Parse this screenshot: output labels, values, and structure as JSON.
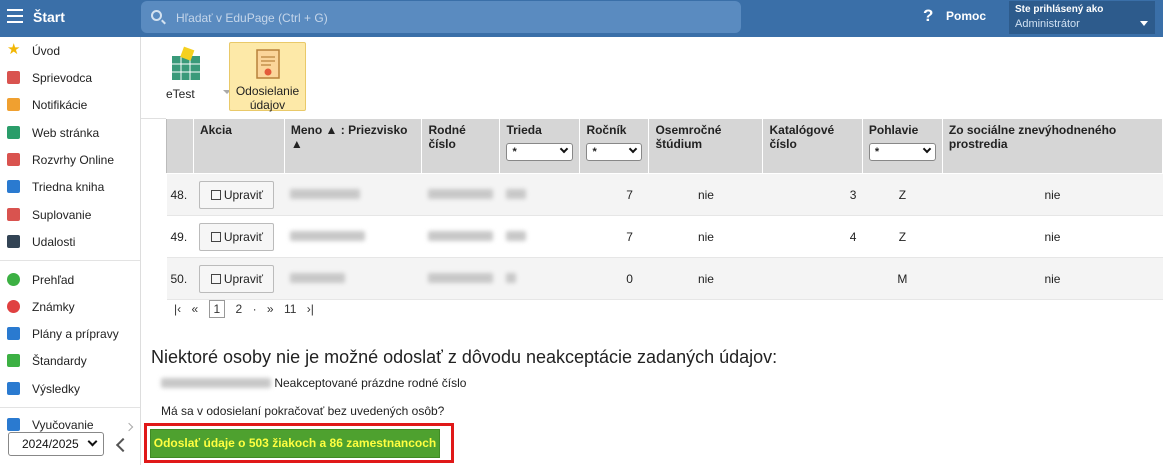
{
  "topbar": {
    "start_label": "Štart",
    "search_placeholder": "Hľadať v EduPage (Ctrl + G)",
    "help_label": "Pomoc",
    "logged_in_label": "Ste prihlásený ako",
    "user_role": "Administrátor"
  },
  "sidebar": {
    "items": [
      {
        "label": "Úvod",
        "icon": "star-icon",
        "color": "#f2b705"
      },
      {
        "label": "Sprievodca",
        "icon": "wand-icon",
        "color": "#d9534f"
      },
      {
        "label": "Notifikácie",
        "icon": "envelope-icon",
        "color": "#f0a030"
      },
      {
        "label": "Web stránka",
        "icon": "home-icon",
        "color": "#2a9d6a"
      },
      {
        "label": "Rozvrhy Online",
        "icon": "calendar-grid-icon",
        "color": "#d9534f"
      },
      {
        "label": "Triedna kniha",
        "icon": "book-icon",
        "color": "#2a7ad0"
      },
      {
        "label": "Suplovanie",
        "icon": "person-icon",
        "color": "#d9534f"
      },
      {
        "label": "Udalosti",
        "icon": "calendar-icon",
        "color": "#334455"
      },
      {
        "label": "Prehľad",
        "icon": "check-circle-icon",
        "color": "#3cb043"
      },
      {
        "label": "Známky",
        "icon": "x-circle-icon",
        "color": "#e04040"
      },
      {
        "label": "Plány a prípravy",
        "icon": "briefcase-icon",
        "color": "#2a7ad0"
      },
      {
        "label": "Štandardy",
        "icon": "shield-check-icon",
        "color": "#3cb043"
      },
      {
        "label": "Výsledky",
        "icon": "bar-chart-icon",
        "color": "#2a7ad0"
      },
      {
        "label": "Vyučovanie",
        "icon": "layers-icon",
        "color": "#2a7ad0"
      }
    ],
    "year": "2024/2025"
  },
  "toolbar": {
    "etest_label": "eTest",
    "send_label_1": "Odosielanie",
    "send_label_2": "údajov"
  },
  "table": {
    "headers": {
      "akcia": "Akcia",
      "meno": "Meno",
      "priezvisko": "Priezvisko",
      "rodne_1": "Rodné",
      "rodne_2": "číslo",
      "trieda": "Trieda",
      "rocnik": "Ročník",
      "osem_1": "Osemročné",
      "osem_2": "štúdium",
      "katal_1": "Katalógové",
      "katal_2": "číslo",
      "pohlavie": "Pohlavie",
      "soc_1": "Zo sociálne znevýhodneného",
      "soc_2": "prostredia",
      "filter_value": "*"
    },
    "edit_label": "Upraviť",
    "rows": [
      {
        "num": "48.",
        "rocnik": "7",
        "osem": "nie",
        "katal": "3",
        "pohl": "Z",
        "soc": "nie"
      },
      {
        "num": "49.",
        "rocnik": "7",
        "osem": "nie",
        "katal": "4",
        "pohl": "Z",
        "soc": "nie"
      },
      {
        "num": "50.",
        "rocnik": "0",
        "osem": "nie",
        "katal": "",
        "pohl": "M",
        "soc": "nie"
      }
    ]
  },
  "pager": {
    "first": "|‹",
    "prev": "«",
    "current": "1",
    "next_page": "2",
    "dot": "·",
    "next": "»",
    "last": "11",
    "last_arrow": "›|"
  },
  "messages": {
    "warning_title": "Niektoré osoby nie je možné odoslať z dôvodu neakceptácie zadaných údajov:",
    "warning_item": "Neakceptované prázdne rodné číslo",
    "question": "Má sa v odosielaní pokračovať bez uvedených osôb?",
    "send_button": "Odoslať údaje o 503 žiakoch a 86 zamestnancoch"
  }
}
